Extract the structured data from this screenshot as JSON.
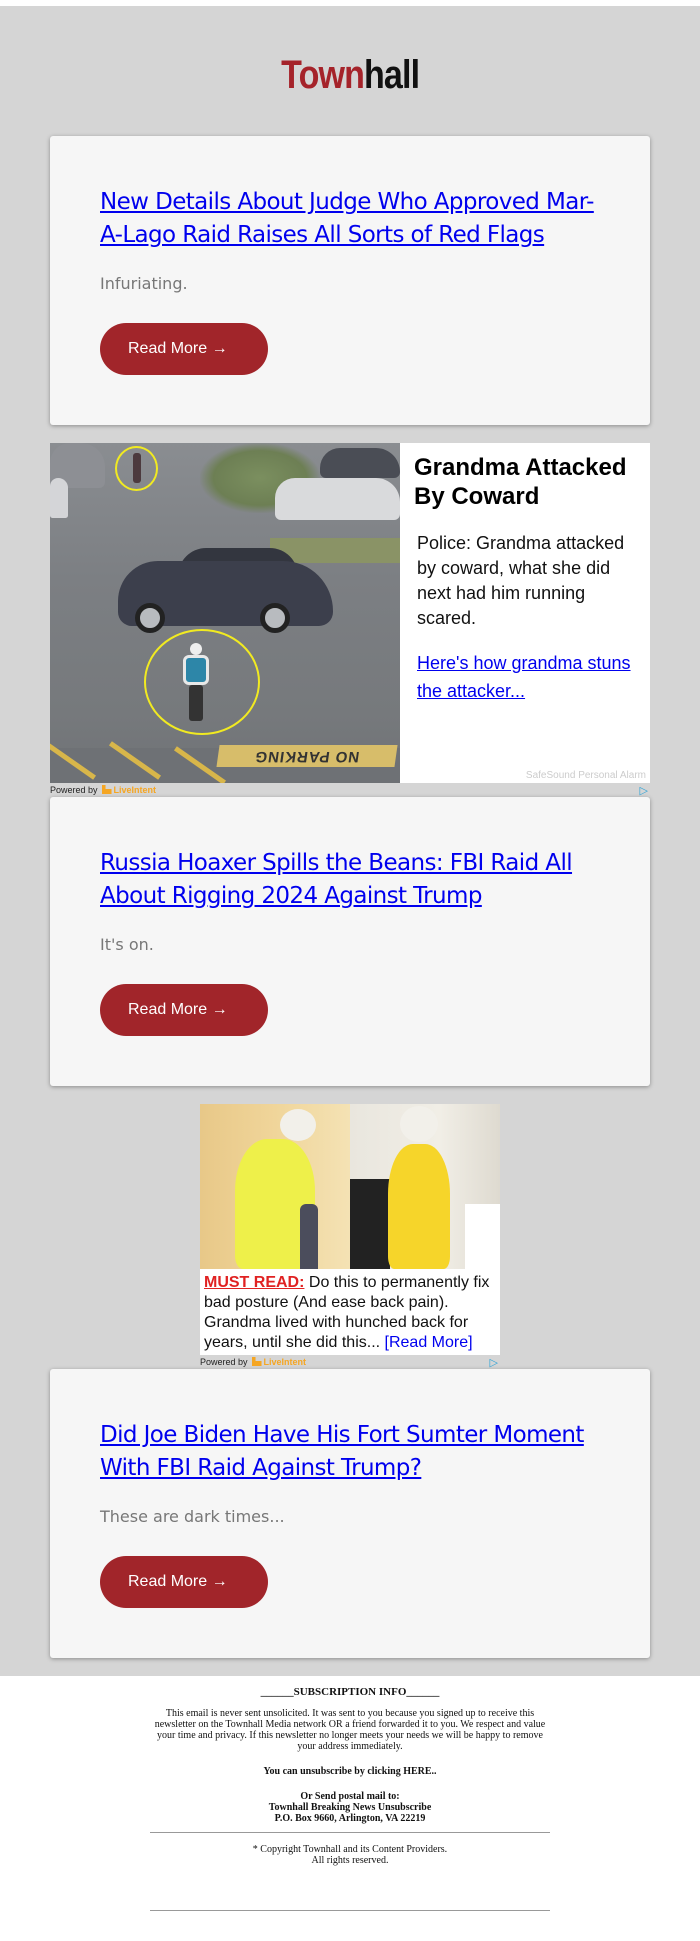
{
  "brand": {
    "logo_part1": "Town",
    "logo_part2": "hall",
    "logo_colors": {
      "town": "#a5232a",
      "hall": "#111111"
    }
  },
  "colors": {
    "page_background": "#d5d5d5",
    "card_background": "#f6f6f6",
    "button_background": "#a1252a",
    "link_color": "#0000ee"
  },
  "articles": [
    {
      "title": "New Details About Judge Who Approved Mar-A-Lago Raid Raises All Sorts of Red Flags",
      "teaser": "Infuriating.",
      "button_label": "Read More →"
    },
    {
      "title": "Russia Hoaxer Spills the Beans: FBI Raid All About Rigging 2024 Against Trump",
      "teaser": "It's on.",
      "button_label": "Read More →"
    },
    {
      "title": "Did Joe Biden Have His Fort Sumter Moment With FBI Raid Against Trump?",
      "teaser": "These are dark times...",
      "button_label": "Read More →"
    }
  ],
  "ads": [
    {
      "headline": "Grandma Attacked By Coward",
      "body": "Police: Grandma attacked by coward, what she did next had him running scared.",
      "link_text": "Here's how grandma stuns the attacker...",
      "sponsor": "SafeSound Personal Alarm",
      "image_overlay_text": "NO PARKING",
      "powered_by_label": "Powered by",
      "powered_by_brand": "LiveIntent"
    },
    {
      "must_read_label": "MUST READ:",
      "body": " Do this to permanently fix bad posture (And ease back pain). Grandma lived with hunched back for years, until she did this... ",
      "link_text": "[Read More]",
      "powered_by_label": "Powered by",
      "powered_by_brand": "LiveIntent"
    }
  ],
  "footer": {
    "subscription_title": "______SUBSCRIPTION INFO______",
    "subscription_body": "This email is never sent unsolicited. It was sent to you because you signed up to receive this newsletter on the Townhall Media network OR a friend forwarded it to you. We respect and value your time and privacy. If this newsletter no longer meets your needs we will be happy to remove your address immediately.",
    "unsubscribe_text": "You can unsubscribe by clicking HERE..",
    "postal_line1": "Or Send postal mail to:",
    "postal_line2": "Townhall Breaking News Unsubscribe",
    "postal_line3": "P.O. Box 9660, Arlington, VA 22219",
    "copyright_line1": "* Copyright Townhall and its Content Providers.",
    "copyright_line2": "All rights reserved."
  }
}
